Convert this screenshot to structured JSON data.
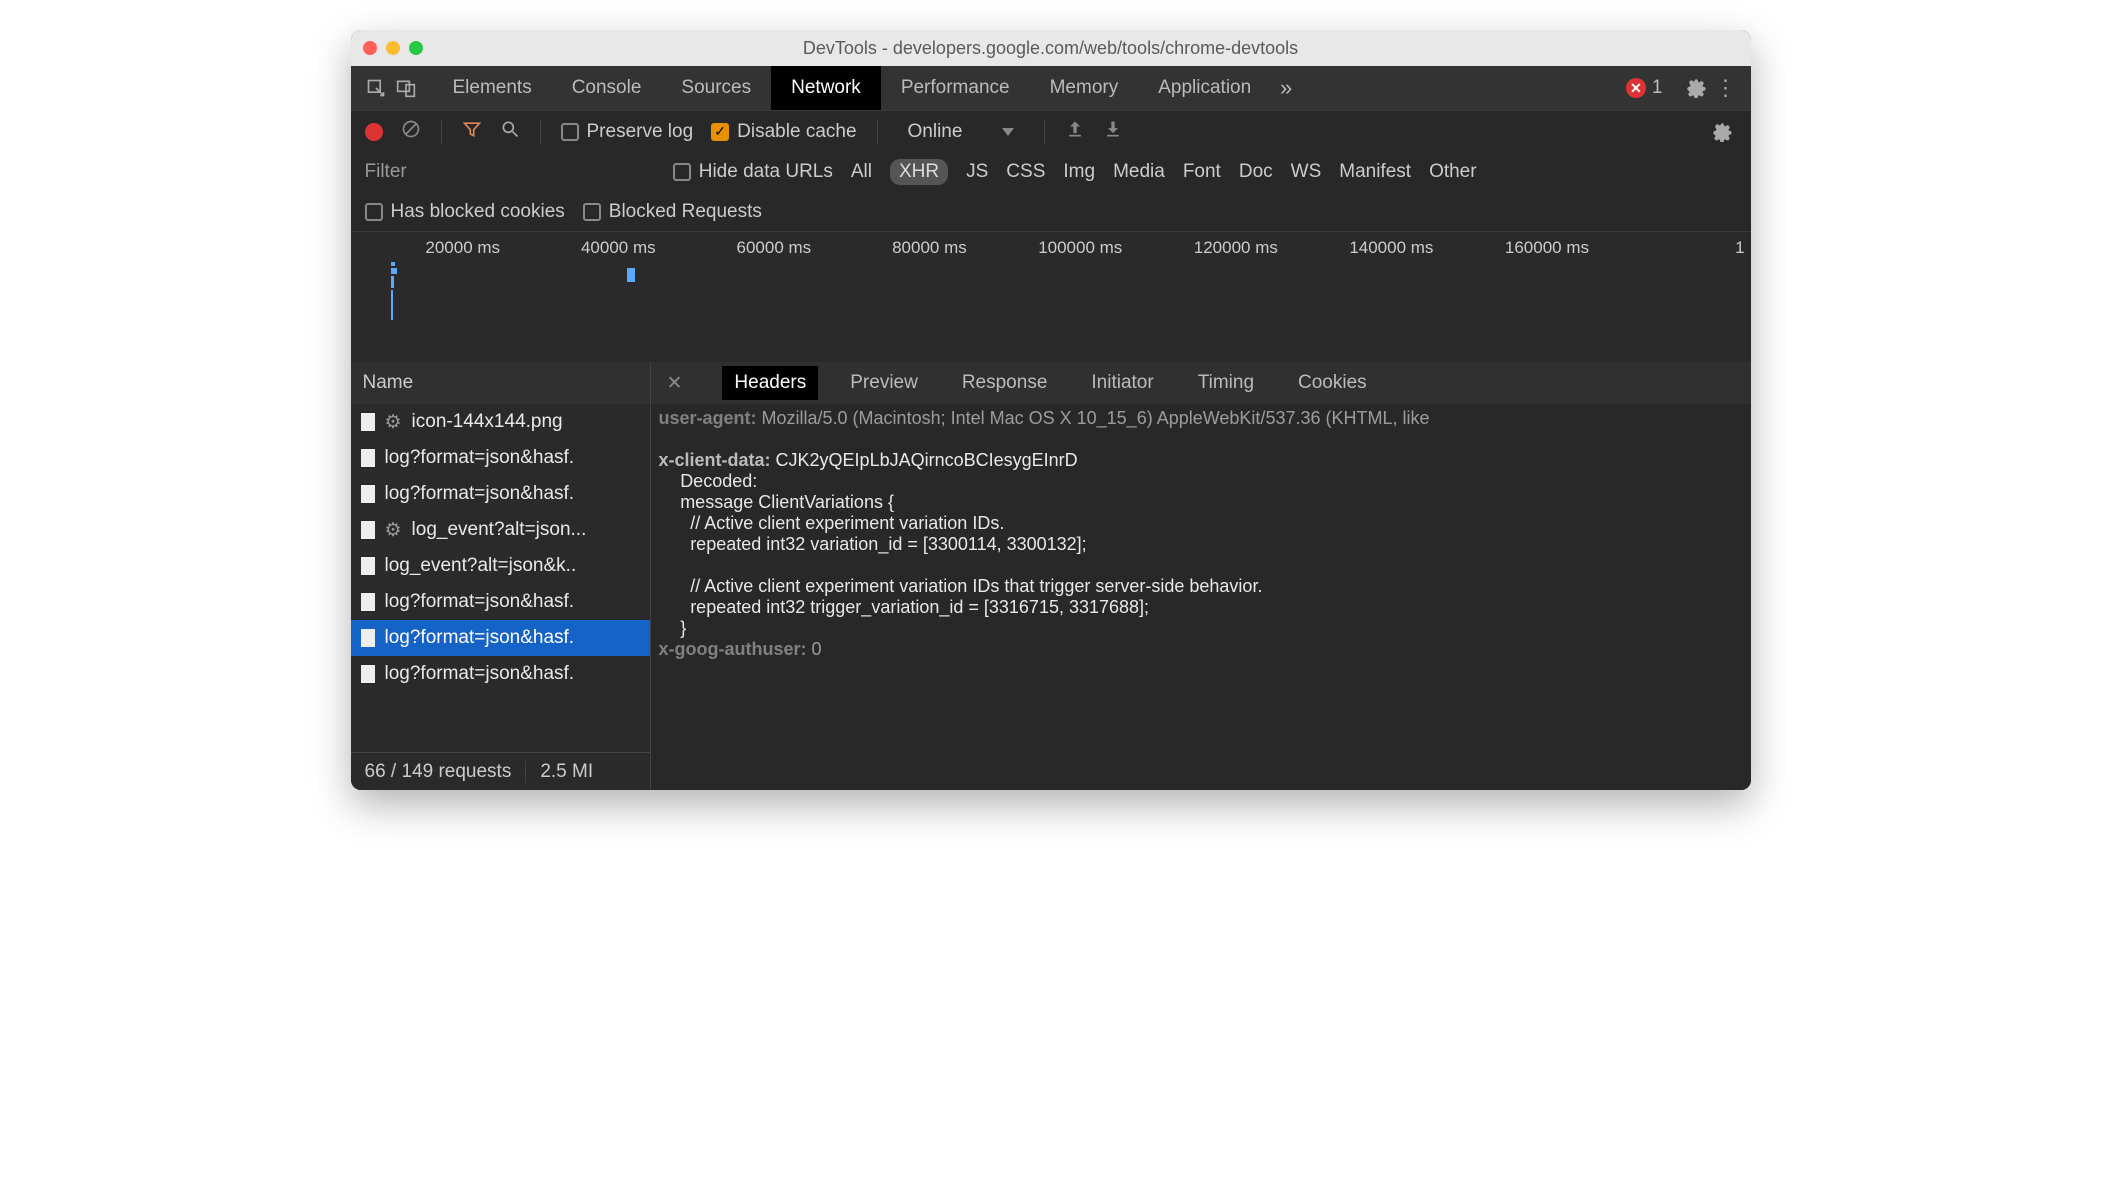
{
  "title": "DevTools - developers.google.com/web/tools/chrome-devtools",
  "traffic_lights": {
    "red": "#ff5f57",
    "yellow": "#febc2e",
    "green": "#28c840"
  },
  "main_tabs": [
    "Elements",
    "Console",
    "Sources",
    "Network",
    "Performance",
    "Memory",
    "Application"
  ],
  "main_tab_active": "Network",
  "overflow_symbol": "»",
  "error_count": "1",
  "toolbar": {
    "preserve_log": "Preserve log",
    "disable_cache": "Disable cache",
    "online": "Online"
  },
  "filterbar": {
    "filter_label": "Filter",
    "hide_data_urls": "Hide data URLs",
    "types": [
      "All",
      "XHR",
      "JS",
      "CSS",
      "Img",
      "Media",
      "Font",
      "Doc",
      "WS",
      "Manifest",
      "Other"
    ],
    "selected_type": "XHR",
    "has_blocked": "Has blocked cookies",
    "blocked_requests": "Blocked Requests"
  },
  "timeline_ticks": [
    "20000 ms",
    "40000 ms",
    "60000 ms",
    "80000 ms",
    "100000 ms",
    "120000 ms",
    "140000 ms",
    "160000 ms",
    "1"
  ],
  "left": {
    "name_header": "Name",
    "requests": [
      {
        "icon": "gear",
        "name": "icon-144x144.png"
      },
      {
        "icon": "doc",
        "name": "log?format=json&hasf."
      },
      {
        "icon": "doc",
        "name": "log?format=json&hasf."
      },
      {
        "icon": "gear",
        "name": "log_event?alt=json..."
      },
      {
        "icon": "doc",
        "name": "log_event?alt=json&k.."
      },
      {
        "icon": "doc",
        "name": "log?format=json&hasf."
      },
      {
        "icon": "doc",
        "name": "log?format=json&hasf.",
        "selected": true
      },
      {
        "icon": "doc",
        "name": "log?format=json&hasf."
      }
    ],
    "status": {
      "count": "66 / 149 requests",
      "size": "2.5 MI"
    }
  },
  "right": {
    "subtabs": [
      "Headers",
      "Preview",
      "Response",
      "Initiator",
      "Timing",
      "Cookies"
    ],
    "subtab_active": "Headers",
    "lines": {
      "ua_key": "user-agent:",
      "ua_val": " Mozilla/5.0 (Macintosh; Intel Mac OS X 10_15_6) AppleWebKit/537.36 (KHTML, like",
      "xcd_key": "x-client-data:",
      "xcd_val": " CJK2yQEIpLbJAQirncoBCIesygEInrD",
      "decoded": "Decoded:",
      "l1": "message ClientVariations {",
      "l2": "  // Active client experiment variation IDs.",
      "l3": "  repeated int32 variation_id = [3300114, 3300132];",
      "blank": "",
      "l4": "  // Active client experiment variation IDs that trigger server-side behavior.",
      "l5": "  repeated int32 trigger_variation_id = [3316715, 3317688];",
      "l6": "}",
      "xg_key": "x-goog-authuser:",
      "xg_val": " 0"
    }
  }
}
